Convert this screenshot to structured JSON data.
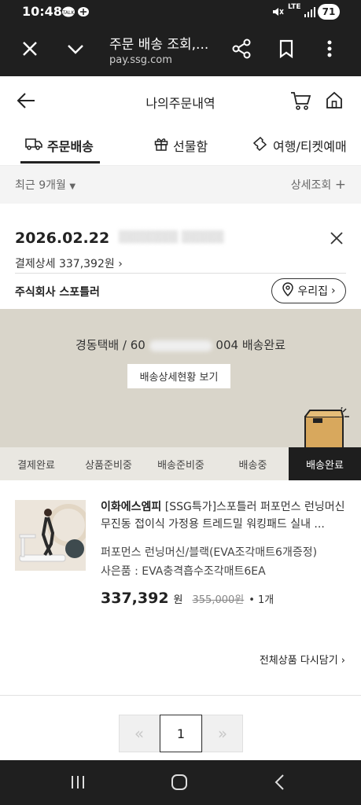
{
  "status_bar": {
    "time": "10:48",
    "battery": "71",
    "network": "LTE"
  },
  "browser": {
    "title": "주문 배송 조회,...",
    "url": "pay.ssg.com"
  },
  "header": {
    "title": "나의주문내역"
  },
  "tabs": [
    {
      "label": "주문배송",
      "icon": "truck-icon",
      "active": true
    },
    {
      "label": "선물함",
      "icon": "gift-icon",
      "active": false
    },
    {
      "label": "여행/티켓예매",
      "icon": "ticket-icon",
      "active": false
    }
  ],
  "filter": {
    "period": "최근 9개월",
    "detail_search": "상세조회"
  },
  "order": {
    "date": "2026.02.22",
    "payment_detail": "결제상세 337,392원",
    "seller": "주식회사 스포틀러",
    "address_button": "우리집"
  },
  "delivery": {
    "carrier": "경동택배 / 60",
    "tracking_tail": "004 배송완료",
    "detail_button": "배송상세현황 보기",
    "steps": [
      "결제완료",
      "상품준비중",
      "배송준비중",
      "배송중",
      "배송완료"
    ],
    "active_step": "배송완료"
  },
  "product": {
    "brand": "이화에스엠피",
    "title": "[SSG특가]스포틀러 퍼포먼스 런닝머신 무진동 접이식 가정용 트레드밀 워킹패드 실내 ...",
    "option": "퍼포먼스 런닝머신/블랙(EVA조각매트6개증정)",
    "gift": "사은품 : EVA충격흡수조각매트6EA",
    "price": "337,392",
    "price_unit": "원",
    "original_price": "355,000원",
    "quantity": "• 1개",
    "recart_link": "전체상품 다시담기"
  },
  "pagination": {
    "current": "1",
    "prev": "«",
    "next": "»"
  },
  "colors": {
    "dark": "#1f1f1f",
    "delivery_bg": "#d9d5ca",
    "progress_bg": "#e9e7e1"
  }
}
